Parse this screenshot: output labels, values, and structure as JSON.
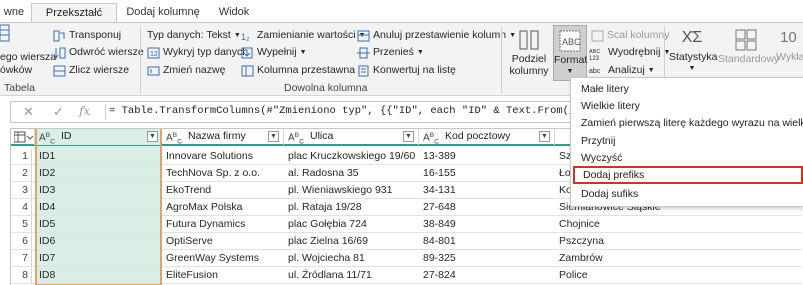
{
  "tabs": [
    {
      "label": "wne"
    },
    {
      "label": "Przekształć"
    },
    {
      "label": "Dodaj kolumnę"
    },
    {
      "label": "Widok"
    }
  ],
  "ribbon": {
    "tabela_group": {
      "name": "Tabela",
      "partial1": "ego wiersza",
      "partial2": "ówków"
    },
    "left_items": [
      "Transponuj",
      "Odwróć wiersze",
      "Zlicz wiersze"
    ],
    "type_items": [
      "Typ danych: Tekst",
      "Wykryj typ danych",
      "Zmień nazwę"
    ],
    "mid_items": [
      "Zamienianie wartości",
      "Wypełnij",
      "Kolumna przestawna"
    ],
    "right_items": [
      "Anuluj przestawienie kolumn",
      "Przenieś",
      "Konwertuj na listę"
    ],
    "dowolna_group": "Dowolna kolumna",
    "podziel": {
      "line1": "Podziel",
      "line2": "kolumny"
    },
    "format": "Format",
    "scal": "Scal kolumny",
    "wyodrebnij": "Wyodrębnij",
    "analizuj": "Analizuj",
    "statystyka": "Statystyka",
    "standardowy": "Standardowy",
    "wykladniczy": "Wykła"
  },
  "formula": "= Table.TransformColumns(#\"Zmieniono typ\", {{\"ID\", each \"ID\" & Text.From(_, \"pl-PL\"),",
  "table": {
    "columns": [
      "ID",
      "Nazwa firmy",
      "Ulica",
      "Kod pocztowy"
    ],
    "type_label": "ABC",
    "rows": [
      {
        "n": "1",
        "id": "ID1",
        "firma": "Innovare Solutions",
        "ulica": "plac Kruczkowskiego 19/60",
        "kod": "13-389",
        "extra": "Szc"
      },
      {
        "n": "2",
        "id": "ID2",
        "firma": "TechNova Sp. z o.o.",
        "ulica": "al. Radosna 35",
        "kod": "16-155",
        "extra": "Łow"
      },
      {
        "n": "3",
        "id": "ID3",
        "firma": "EkoTrend",
        "ulica": "pl. Wieniawskiego 931",
        "kod": "34-131",
        "extra": "Ko"
      },
      {
        "n": "4",
        "id": "ID4",
        "firma": "AgroMax Polska",
        "ulica": "pl. Rataja 19/28",
        "kod": "27-648",
        "extra": "Siemianowice Śląskie"
      },
      {
        "n": "5",
        "id": "ID5",
        "firma": "Futura Dynamics",
        "ulica": "plac Gołębia 724",
        "kod": "38-849",
        "extra": "Chojnice"
      },
      {
        "n": "6",
        "id": "ID6",
        "firma": "OptiServe",
        "ulica": "plac Zielna 16/69",
        "kod": "84-801",
        "extra": "Pszczyna"
      },
      {
        "n": "7",
        "id": "ID7",
        "firma": "GreenWay Systems",
        "ulica": "pl. Wojciecha 81",
        "kod": "89-325",
        "extra": "Zambrów"
      },
      {
        "n": "8",
        "id": "ID8",
        "firma": "EliteFusion",
        "ulica": "ul. Źródlana 11/71",
        "kod": "27-824",
        "extra": "Police"
      }
    ]
  },
  "menu": {
    "items": [
      "Małe litery",
      "Wielkie litery",
      "Zamień pierwszą literę każdego wyrazu na wielką",
      "Przytnij",
      "Wyczyść",
      "Dodaj prefiks",
      "Dodaj sufiks"
    ],
    "highlighted": "Dodaj prefiks"
  },
  "colors": {
    "accent": "#2e9b8e",
    "selection": "#d9efe6",
    "highlight_border": "#c0392b",
    "column_frame": "#e4a06a"
  }
}
